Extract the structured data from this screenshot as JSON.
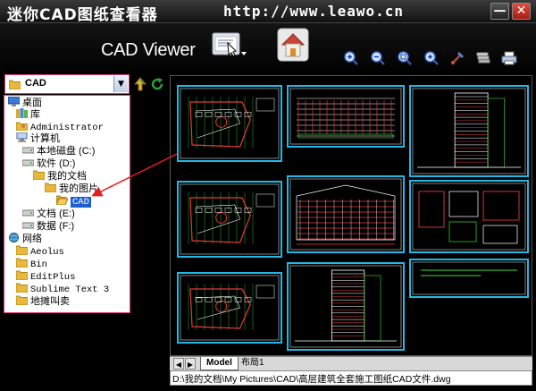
{
  "window": {
    "title": "迷你CAD图纸查看器",
    "url": "http://www.leawo.cn",
    "minimize_label": "—",
    "close_label": "✕"
  },
  "toolbar": {
    "brand": "CAD Viewer",
    "icons": [
      "open-file-icon",
      "home-icon",
      "zoom-in-icon",
      "zoom-out-icon",
      "zoom-extents-icon",
      "zoom-window-icon",
      "pan-icon",
      "layers-icon",
      "print-icon"
    ]
  },
  "explorer": {
    "path_value": "CAD",
    "tree": [
      {
        "label": "桌面",
        "icon": "desktop"
      },
      {
        "label": "库",
        "icon": "library"
      },
      {
        "label": "Administrator",
        "icon": "user"
      },
      {
        "label": "计算机",
        "icon": "computer"
      },
      {
        "label": "本地磁盘 (C:)",
        "icon": "drive"
      },
      {
        "label": "软件 (D:)",
        "icon": "drive"
      },
      {
        "label": "我的文档",
        "icon": "folder"
      },
      {
        "label": "我的图片",
        "icon": "folder"
      },
      {
        "label": "CAD",
        "icon": "folder-open",
        "selected": true
      },
      {
        "label": "文档 (E:)",
        "icon": "drive"
      },
      {
        "label": "数据 (F:)",
        "icon": "drive"
      },
      {
        "label": "网络",
        "icon": "network"
      },
      {
        "label": "Aeolus",
        "icon": "folder"
      },
      {
        "label": "Bin",
        "icon": "folder"
      },
      {
        "label": "EditPlus",
        "icon": "folder"
      },
      {
        "label": "Sublime Text 3",
        "icon": "folder"
      },
      {
        "label": "地摊叫卖",
        "icon": "folder"
      }
    ]
  },
  "tabs": {
    "model": "Model",
    "layout1": "布局1"
  },
  "status": {
    "path": "D:\\我的文档\\My Pictures\\CAD\\高层建筑全套施工图纸CAD文件.dwg"
  },
  "colors": {
    "frame": "#23b7e5",
    "wall": "#e83a3a",
    "line_white": "#ffffff",
    "line_green": "#38e038",
    "selection": "#1d5fd1",
    "highlight_border": "#e03a7b"
  }
}
